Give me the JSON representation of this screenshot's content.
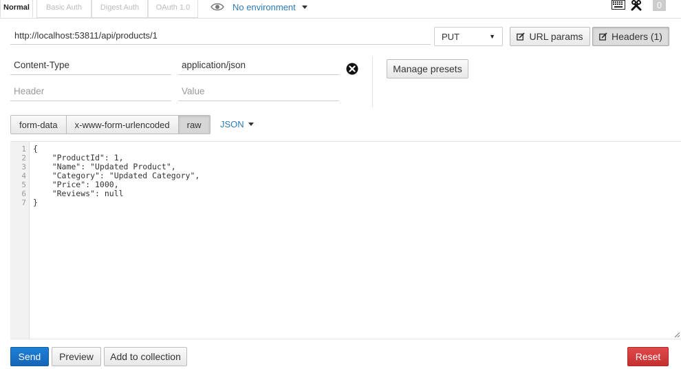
{
  "auth_tabs": [
    {
      "label": "Normal",
      "active": true
    },
    {
      "label": "Basic Auth",
      "active": false
    },
    {
      "label": "Digest Auth",
      "active": false
    },
    {
      "label": "OAuth 1.0",
      "active": false
    }
  ],
  "environment": {
    "label": "No environment"
  },
  "top_right": {
    "badge": "0"
  },
  "request": {
    "url": "http://localhost:53811/api/products/1",
    "method": "PUT",
    "url_params_label": "URL params",
    "headers_label": "Headers (1)"
  },
  "headers": {
    "rows": [
      {
        "key": "Content-Type",
        "value": "application/json"
      }
    ],
    "key_placeholder": "Header",
    "value_placeholder": "Value",
    "manage_presets_label": "Manage presets"
  },
  "body_types": {
    "items": [
      "form-data",
      "x-www-form-urlencoded",
      "raw"
    ],
    "active": "raw",
    "format": "JSON"
  },
  "editor": {
    "line_numbers": [
      "1",
      "2",
      "3",
      "4",
      "5",
      "6",
      "7"
    ],
    "lines": [
      "{",
      "    \"ProductId\": 1,",
      "    \"Name\": \"Updated Product\",",
      "    \"Category\": \"Updated Category\",",
      "    \"Price\": 1000,",
      "    \"Reviews\": null",
      "}"
    ]
  },
  "actions": {
    "send": "Send",
    "preview": "Preview",
    "add_to_collection": "Add to collection",
    "reset": "Reset"
  },
  "colors": {
    "send": "#1565b8",
    "reset": "#c62f2f",
    "link": "#2a7ab5"
  }
}
